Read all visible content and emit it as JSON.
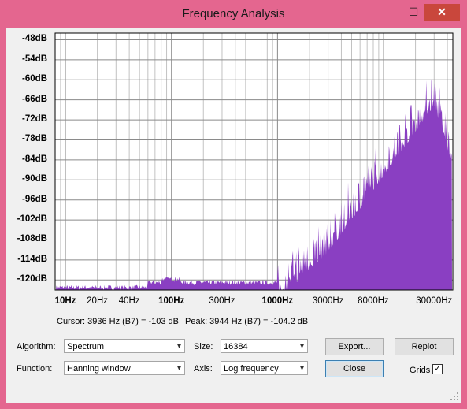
{
  "window": {
    "title": "Frequency Analysis",
    "minimize_glyph": "—",
    "maximize_glyph": "☐",
    "close_glyph": "✕"
  },
  "plot": {
    "y_labels": [
      "-48dB",
      "-54dB",
      "-60dB",
      "-66dB",
      "-72dB",
      "-78dB",
      "-84dB",
      "-90dB",
      "-96dB",
      "-102dB",
      "-108dB",
      "-114dB",
      "-120dB"
    ],
    "x_labels": [
      {
        "text": "10Hz",
        "bold": true
      },
      {
        "text": "20Hz",
        "bold": false
      },
      {
        "text": "40Hz",
        "bold": false
      },
      {
        "text": "100Hz",
        "bold": true
      },
      {
        "text": "300Hz",
        "bold": false
      },
      {
        "text": "1000Hz",
        "bold": true
      },
      {
        "text": "3000Hz",
        "bold": false
      },
      {
        "text": "8000Hz",
        "bold": false
      },
      {
        "text": "30000Hz",
        "bold": false
      }
    ],
    "spectrum_color": "#8a3fc2"
  },
  "status": {
    "cursor": "Cursor: 3936 Hz (B7) = -103 dB",
    "peak": "Peak: 3944 Hz (B7) = -104.2 dB"
  },
  "controls": {
    "algorithm_label": "Algorithm:",
    "algorithm_value": "Spectrum",
    "function_label": "Function:",
    "function_value": "Hanning window",
    "size_label": "Size:",
    "size_value": "16384",
    "axis_label": "Axis:",
    "axis_value": "Log frequency",
    "export_label": "Export...",
    "replot_label": "Replot",
    "close_label": "Close",
    "grids_label": "Grids",
    "grids_checked": true,
    "dropdown_glyph": "▾",
    "check_glyph": "✓"
  }
}
